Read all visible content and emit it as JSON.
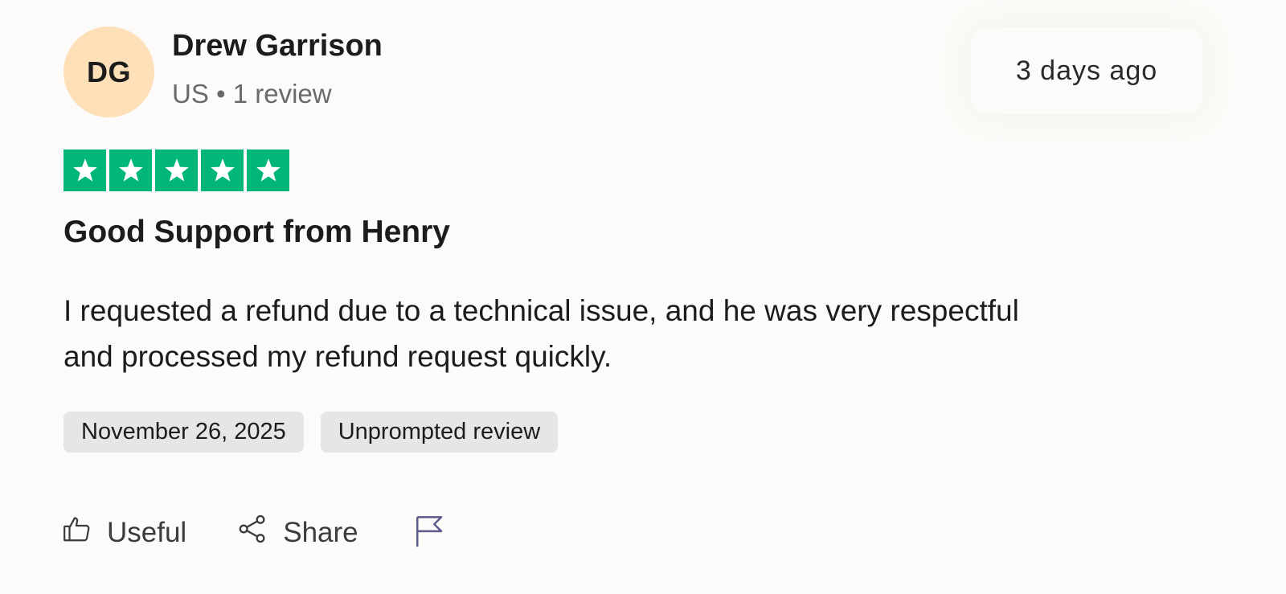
{
  "reviewer": {
    "initials": "DG",
    "name": "Drew Garrison",
    "meta": "US • 1 review",
    "avatar_color": "#fde0b8"
  },
  "posted": {
    "relative_time": "3 days ago"
  },
  "rating": {
    "stars": 5,
    "max": 5,
    "star_color": "#00b67a"
  },
  "review": {
    "title": "Good Support from Henry",
    "body": "I requested a refund due to a technical issue, and he was very respectful and processed my refund request quickly."
  },
  "tags": {
    "date": "November 26, 2025",
    "type": "Unprompted review"
  },
  "actions": {
    "useful_label": "Useful",
    "useful_icon": "thumbs-up-icon",
    "share_label": "Share",
    "share_icon": "share-icon",
    "flag_icon": "flag-icon",
    "flag_color": "#5a5a8c"
  }
}
